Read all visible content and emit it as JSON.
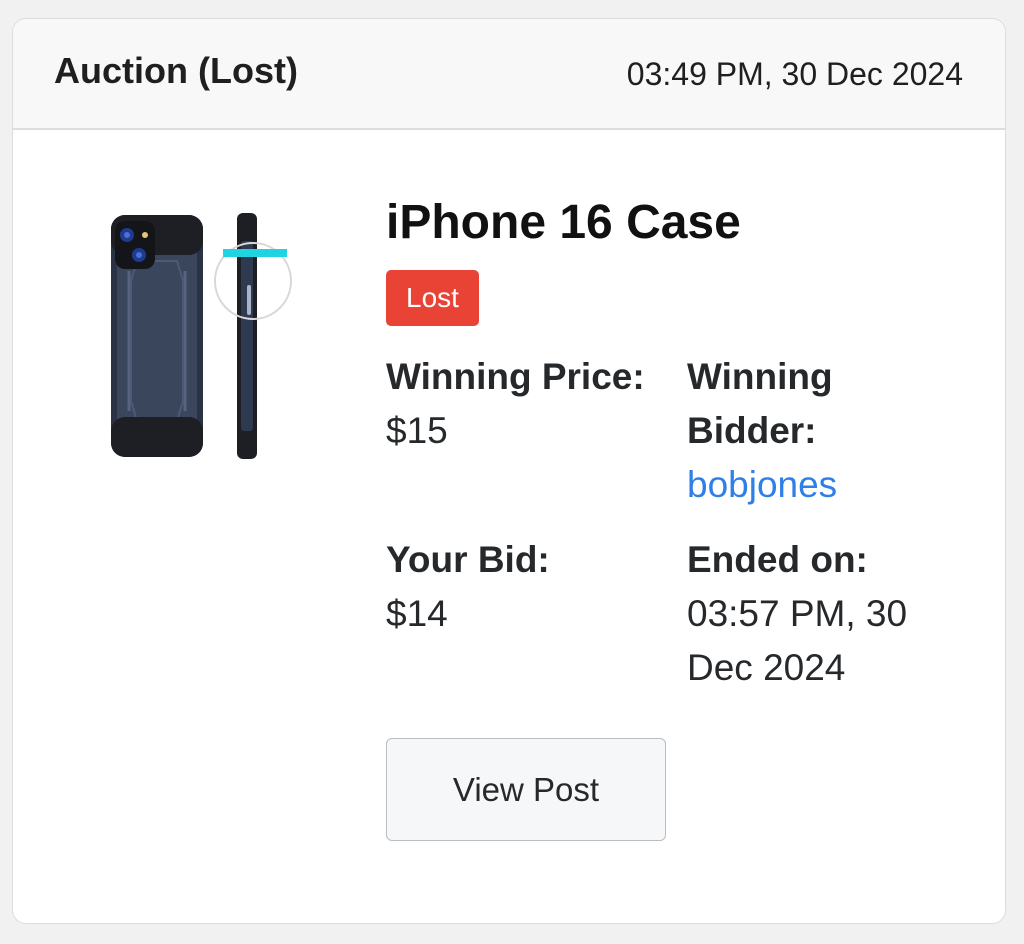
{
  "header": {
    "title": "Auction (Lost)",
    "timestamp": "03:49 PM, 30 Dec 2024"
  },
  "item": {
    "image_icon": "phone-case-image",
    "title": "iPhone 16 Case",
    "status": "Lost",
    "status_color": "#e84335"
  },
  "details": {
    "winning_price_label": "Winning Price:",
    "winning_price_value": "$15",
    "winning_bidder_label": "Winning Bidder:",
    "winning_bidder_value": "bobjones",
    "your_bid_label": "Your Bid:",
    "your_bid_value": "$14",
    "ended_on_label": "Ended on:",
    "ended_on_value": "03:57 PM, 30 Dec 2024"
  },
  "actions": {
    "view_post_label": "View Post"
  },
  "colors": {
    "link": "#2f7fe8",
    "accent_cyan": "#1fd3e0"
  }
}
